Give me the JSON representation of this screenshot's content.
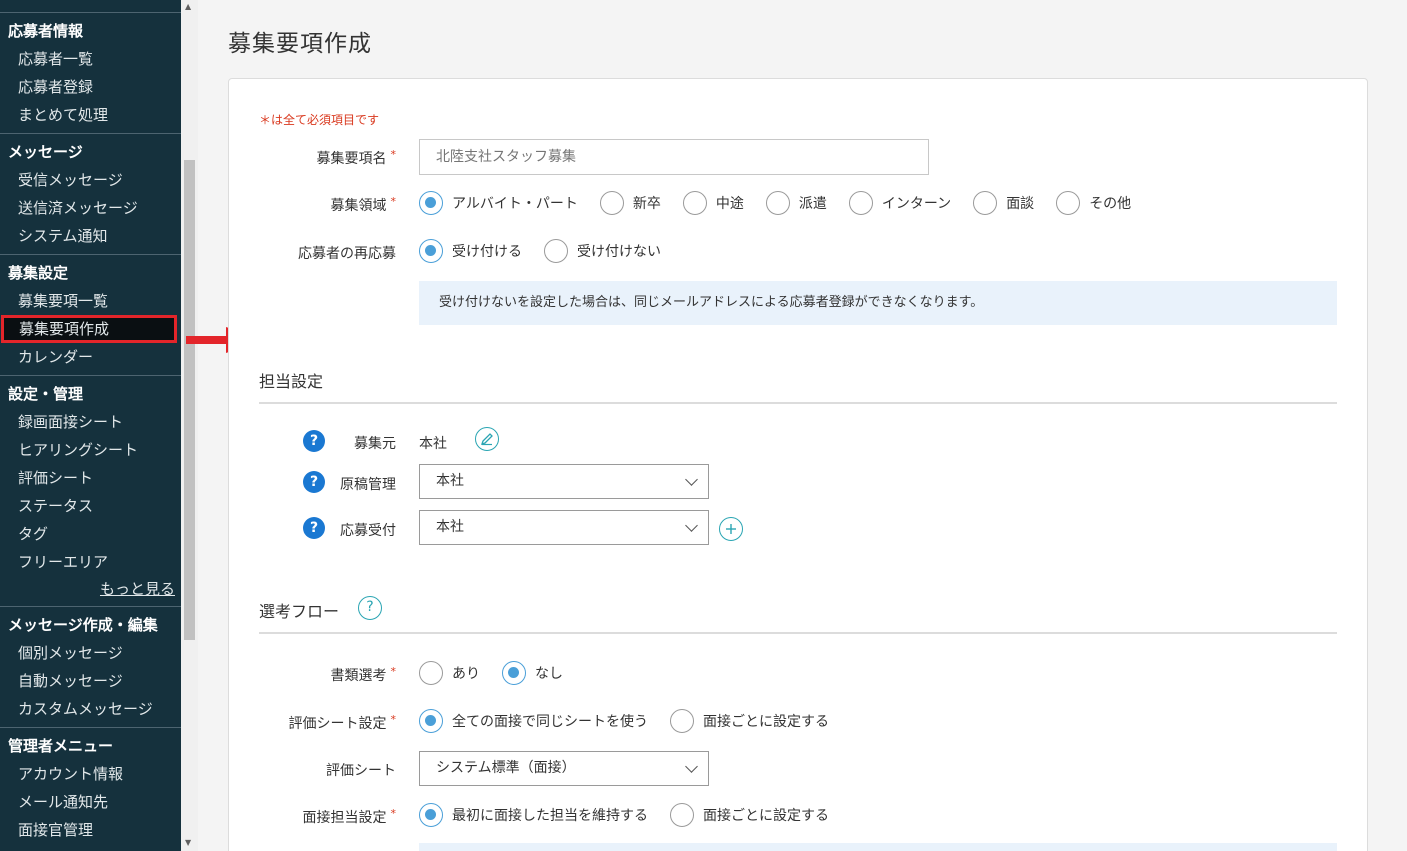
{
  "sidebar": {
    "sections": [
      {
        "heading": "応募者情報",
        "items": [
          "応募者一覧",
          "応募者登録",
          "まとめて処理"
        ]
      },
      {
        "heading": "メッセージ",
        "items": [
          "受信メッセージ",
          "送信済メッセージ",
          "システム通知"
        ]
      },
      {
        "heading": "募集設定",
        "items": [
          "募集要項一覧",
          "募集要項作成",
          "カレンダー"
        ]
      },
      {
        "heading": "設定・管理",
        "items": [
          "録画面接シート",
          "ヒアリングシート",
          "評価シート",
          "ステータス",
          "タグ",
          "フリーエリア"
        ],
        "more": "もっと見る"
      },
      {
        "heading": "メッセージ作成・編集",
        "items": [
          "個別メッセージ",
          "自動メッセージ",
          "カスタムメッセージ"
        ]
      },
      {
        "heading": "管理者メニュー",
        "items": [
          "アカウント情報",
          "メール通知先",
          "面接官管理"
        ]
      }
    ],
    "active_item": "募集要項作成"
  },
  "page": {
    "title": "募集要項作成",
    "required_note": "＊は全て必須項目です",
    "fields": {
      "name_label": "募集要項名",
      "name_placeholder": "北陸支社スタッフ募集",
      "area_label": "募集領域",
      "area_options": [
        "アルバイト・パート",
        "新卒",
        "中途",
        "派遣",
        "インターン",
        "面談",
        "その他"
      ],
      "area_selected": "アルバイト・パート",
      "reapply_label": "応募者の再応募",
      "reapply_options": [
        "受け付ける",
        "受け付けない"
      ],
      "reapply_selected": "受け付ける",
      "reapply_info": "受け付けないを設定した場合は、同じメールアドレスによる応募者登録ができなくなります。"
    },
    "tanto": {
      "title": "担当設定",
      "source_label": "募集元",
      "source_value": "本社",
      "manuscript_label": "原稿管理",
      "manuscript_value": "本社",
      "reception_label": "応募受付",
      "reception_value": "本社"
    },
    "flow": {
      "title": "選考フロー",
      "doc_label": "書類選考",
      "doc_options": [
        "あり",
        "なし"
      ],
      "doc_selected": "なし",
      "eval_setting_label": "評価シート設定",
      "eval_setting_options": [
        "全ての面接で同じシートを使う",
        "面接ごとに設定する"
      ],
      "eval_setting_selected": "全ての面接で同じシートを使う",
      "eval_sheet_label": "評価シート",
      "eval_sheet_value": "システム標準（面接）",
      "interviewer_label": "面接担当設定",
      "interviewer_options": [
        "最初に面接した担当を維持する",
        "面接ごとに設定する"
      ],
      "interviewer_selected": "最初に面接した担当を維持する"
    },
    "required_mark": "*",
    "help_glyph": "?"
  },
  "colors": {
    "sidebar_bg": "#15313d",
    "accent": "#4a9fd8",
    "required": "#d9381e",
    "teal": "#2aa5b3",
    "help_blue": "#1a78d2",
    "highlight": "#e3252a"
  }
}
